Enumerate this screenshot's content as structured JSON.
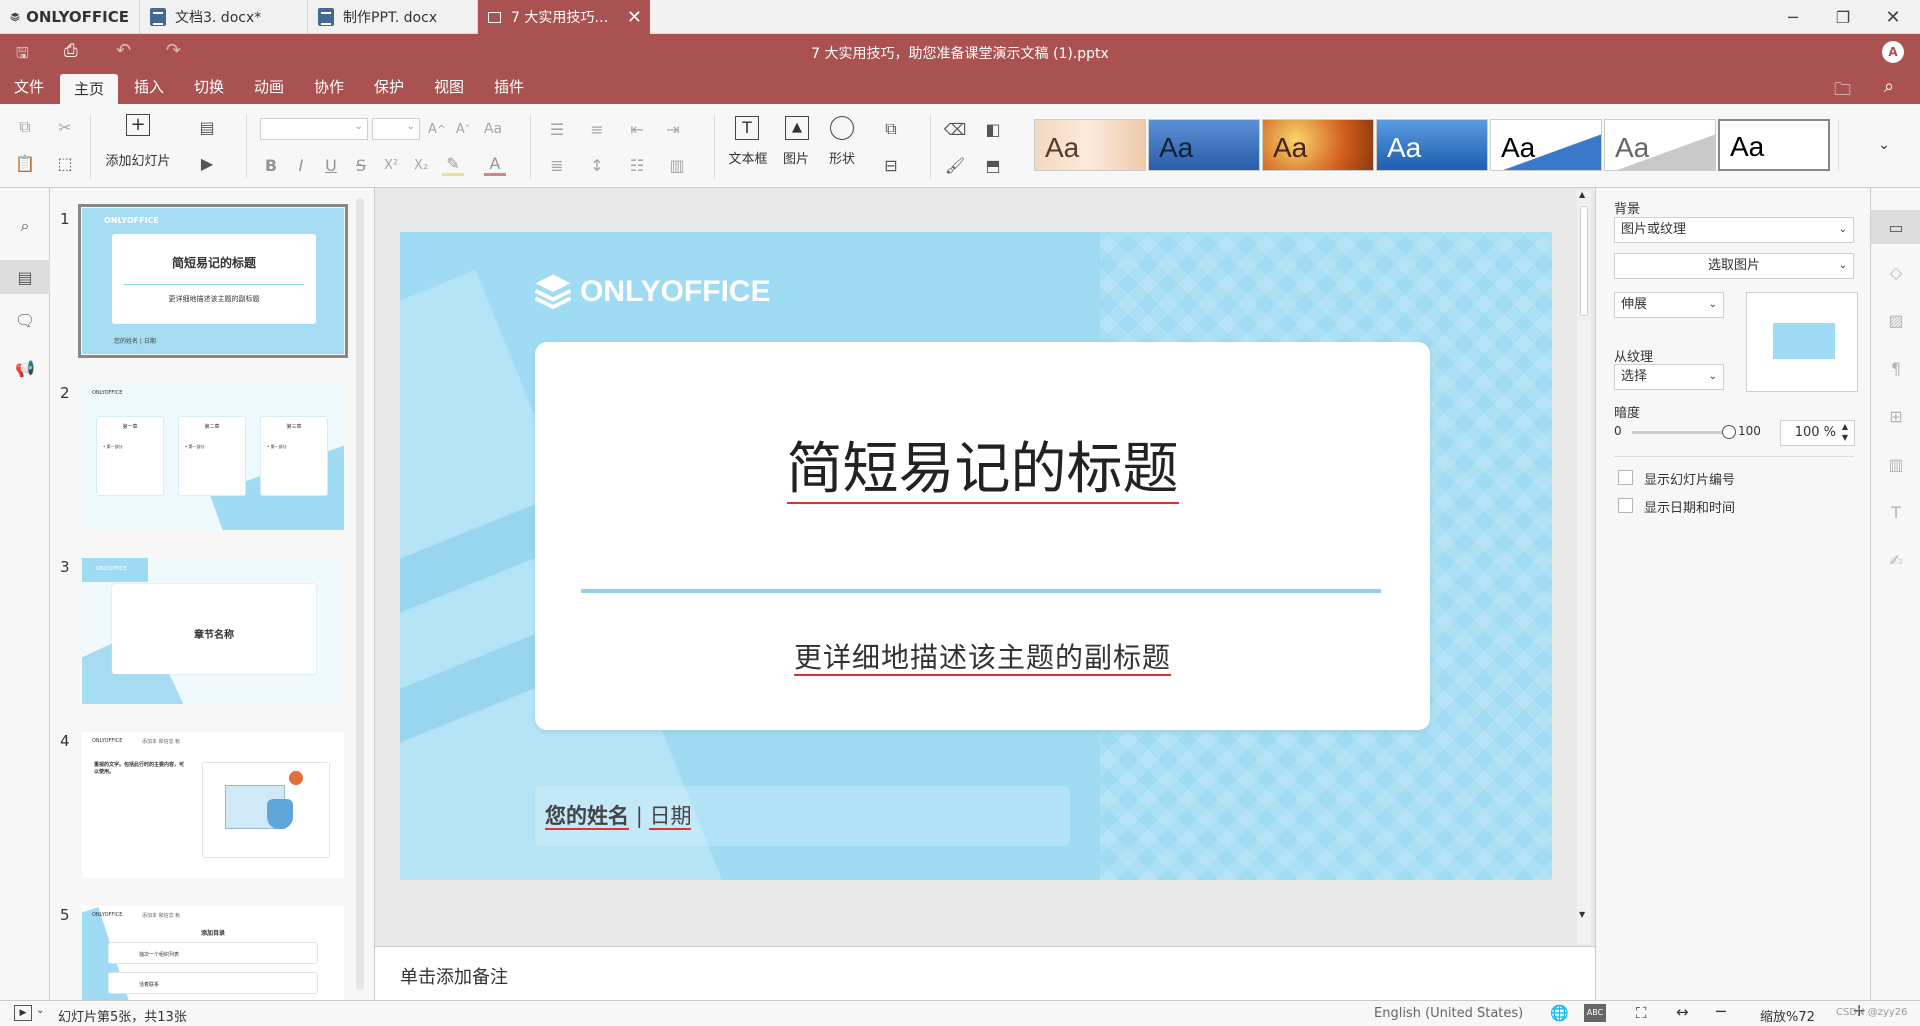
{
  "tabs": {
    "brand": "ONLYOFFICE",
    "doc1": "文档3. docx*",
    "doc2": "制作PPT. docx",
    "doc3": "7 大实用技巧…"
  },
  "title": "7 大实用技巧，助您准备课堂演示文稿 (1).pptx",
  "avatar": "A",
  "menu": [
    "文件",
    "主页",
    "插入",
    "切换",
    "动画",
    "协作",
    "保护",
    "视图",
    "插件"
  ],
  "toolbar": {
    "add_slide": "添加幻灯片",
    "textbox": "文本框",
    "image": "图片",
    "shape": "形状",
    "theme_label": "Aa",
    "bold": "B",
    "italic": "I",
    "underline": "U",
    "strike": "S"
  },
  "slides": [
    {
      "num": "1",
      "brand": "ONLYOFFICE",
      "title": "简短易记的标题",
      "subtitle": "更详细地描述该主题的副标题",
      "footer": "您的姓名 | 日期"
    },
    {
      "num": "2",
      "brand": "ONLYOFFICE",
      "col1": "第一章",
      "col2": "第二章",
      "col3": "第三章",
      "bullet": "• 第一部分"
    },
    {
      "num": "3",
      "brand": "ONLYOFFICE",
      "title": "章节名称"
    },
    {
      "num": "4",
      "brand": "ONLYOFFICE",
      "header": "添加本 和信息 帐",
      "text": "重视的文字。包括此行时的主要内容，可以使用。"
    },
    {
      "num": "5",
      "brand": "ONLYOFFICE",
      "header": "添加本 和信息 帐",
      "title": "添加目录",
      "item1": "独次一个组织列表",
      "item2": "活着联系"
    }
  ],
  "main_slide": {
    "brand": "ONLYOFFICE",
    "title": "简短易记的标题",
    "subtitle": "更详细地描述该主题的副标题",
    "name": "您的姓名",
    "sep": "|",
    "date": "日期"
  },
  "notes_placeholder": "单击添加备注",
  "panel": {
    "background_label": "背景",
    "fill_type": "图片或纹理",
    "select_image": "选取图片",
    "stretch": "伸展",
    "from_texture": "从纹理",
    "select": "选择",
    "transparency": "暗度",
    "min": "0",
    "max": "100",
    "percent": "100 %",
    "show_slide_number": "显示幻灯片编号",
    "show_date_time": "显示日期和时间"
  },
  "status": {
    "slide_info": "幻灯片第5张，共13张",
    "language": "English (United States)",
    "zoom": "缩放%72",
    "watermark": "CSDN @zyy26"
  },
  "colors": {
    "accent": "#aa5252",
    "slide_bg": "#9fdbf3",
    "line": "#8fd0ec"
  }
}
